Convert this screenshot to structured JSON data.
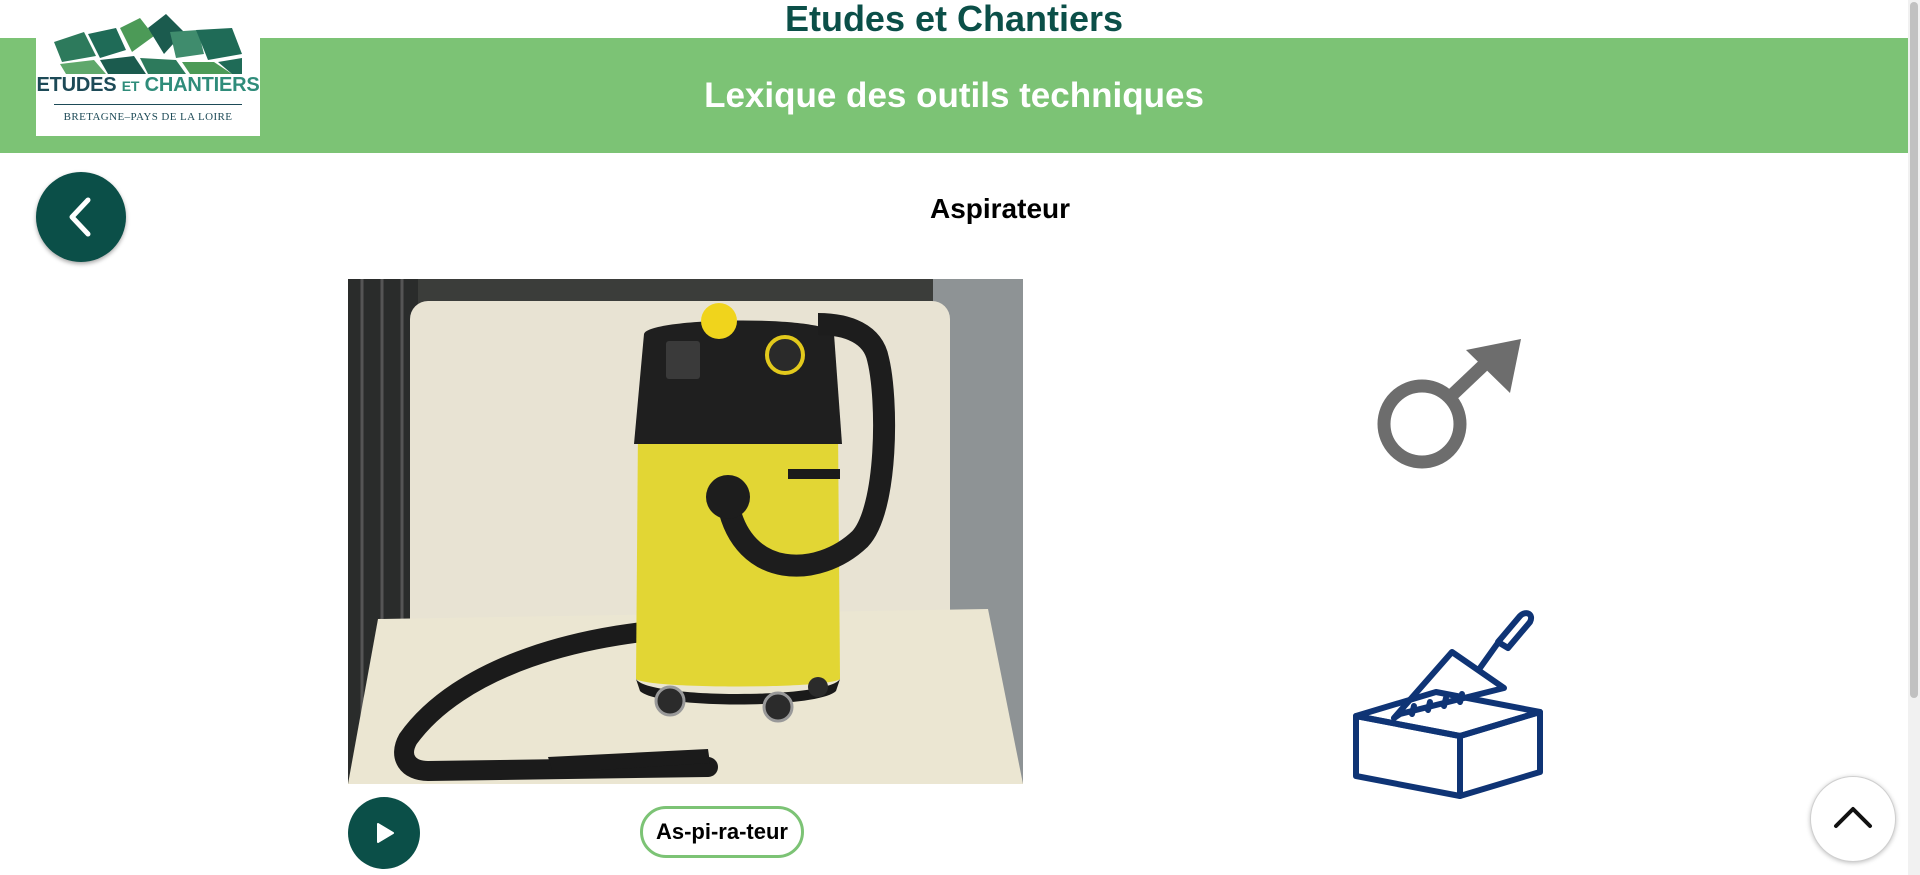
{
  "header": {
    "site_title": "Etudes et Chantiers",
    "banner_title": "Lexique des outils techniques",
    "logo": {
      "line_part1": "ETUDES",
      "line_part2": "ET",
      "line_part3": "CHANTIERS",
      "subtitle": "BRETAGNE–PAYS DE LA LOIRE"
    }
  },
  "entry": {
    "word": "Aspirateur",
    "syllables": "As-pi-ra-teur",
    "gender_icon": "male-symbol-icon",
    "category_icon": "brick-trowel-icon",
    "photo_icon": "vacuum-cleaner-photo"
  },
  "navigation": {
    "back_icon": "chevron-left-icon",
    "play_icon": "play-icon",
    "top_icon": "chevron-up-icon"
  },
  "colors": {
    "brand_dark": "#0b4f48",
    "brand_green": "#7cc375",
    "icon_gray": "#6d6d6d",
    "icon_navy": "#0f3475"
  }
}
